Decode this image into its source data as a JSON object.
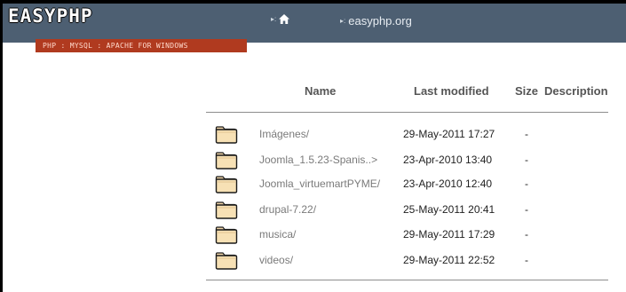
{
  "brand": {
    "logo_text": "EASYPHP",
    "tagline": "PHP : MYSQL : APACHE FOR WINDOWS"
  },
  "nav": {
    "home_separator": "▸:",
    "site_separator": "▸:",
    "site_label": "easyphp.org"
  },
  "table": {
    "columns": {
      "name": "Name",
      "last_modified": "Last modified",
      "size": "Size",
      "description": "Description"
    },
    "rows": [
      {
        "name": "Imágenes/",
        "modified": "29-May-2011 17:27",
        "size": "-"
      },
      {
        "name": "Joomla_1.5.23-Spanis..>",
        "modified": "23-Apr-2010 13:40",
        "size": "-"
      },
      {
        "name": "Joomla_virtuemartPYME/",
        "modified": "23-Apr-2010 12:40",
        "size": "-"
      },
      {
        "name": "drupal-7.22/",
        "modified": "25-May-2011 20:41",
        "size": "-"
      },
      {
        "name": "musica/",
        "modified": "29-May-2011 17:29",
        "size": "-"
      },
      {
        "name": "videos/",
        "modified": "29-May-2011 22:52",
        "size": "-"
      }
    ]
  },
  "colors": {
    "header_bg": "#4d5f72",
    "tagline_bg": "#b03a1f",
    "folder_fill": "#f5deb3"
  },
  "icons": {
    "folder": "folder-icon",
    "home": "home-icon"
  }
}
